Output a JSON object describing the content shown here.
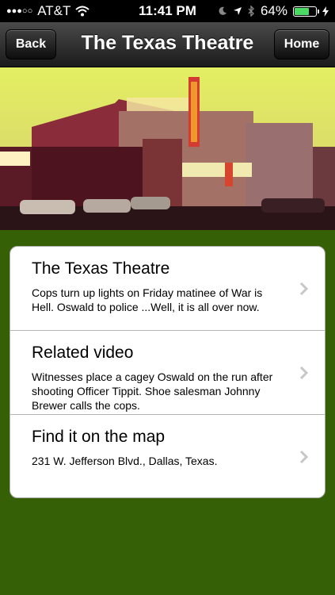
{
  "status_bar": {
    "signal_dots": "●●●○○",
    "carrier": "AT&T",
    "time": "11:41 PM",
    "battery_percent": "64%",
    "battery_level": 0.64
  },
  "nav": {
    "back_label": "Back",
    "title": "The Texas Theatre",
    "home_label": "Home"
  },
  "items": [
    {
      "title": "The Texas Theatre",
      "description": "Cops turn up lights on Friday matinee of War is Hell. Oswald to police ...Well, it is all over now."
    },
    {
      "title": "Related video",
      "description": "Witnesses place a cagey Oswald on the run after shooting Officer Tippit. Shoe salesman Johnny Brewer calls the cops."
    },
    {
      "title": "Find it on the map",
      "description": "231 W. Jefferson Blvd., Dallas, Texas."
    }
  ],
  "colors": {
    "background": "#356006",
    "card": "#ffffff",
    "battery": "#4cd964"
  }
}
